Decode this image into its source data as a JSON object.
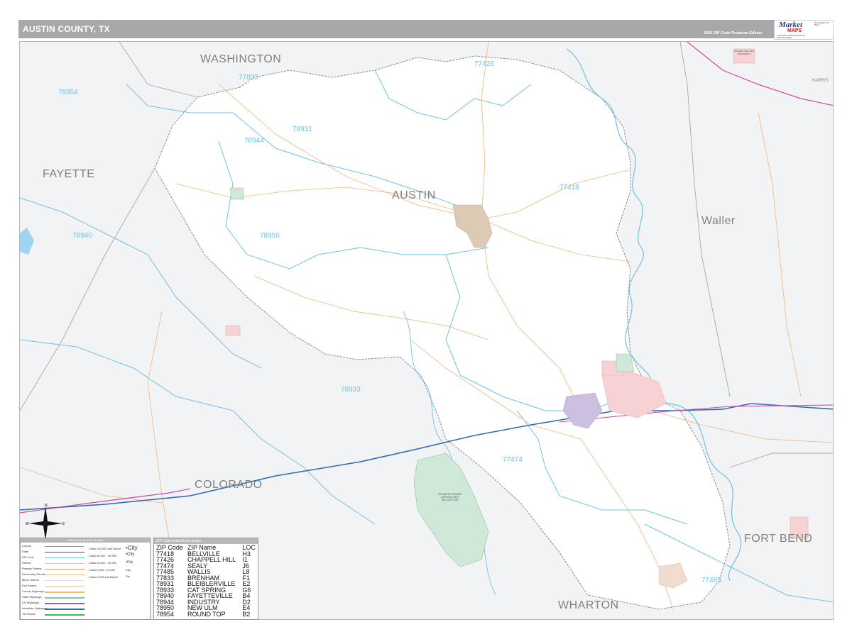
{
  "header": {
    "title": "AUSTIN COUNTY, TX",
    "edition": "2026 ZIP Code Premium Edition"
  },
  "logo": {
    "brand_top": "Market",
    "brand_bottom": "MAPS",
    "tagline": "America's Leading Source of Business Maps",
    "slogan": "The Navigator, The Places"
  },
  "map": {
    "counties": [
      {
        "id": "washington",
        "label": "WASHINGTON"
      },
      {
        "id": "fayette",
        "label": "FAYETTE"
      },
      {
        "id": "austin",
        "label": "AUSTIN"
      },
      {
        "id": "waller",
        "label": "Waller"
      },
      {
        "id": "colorado",
        "label": "COLORADO"
      },
      {
        "id": "fortbend",
        "label": "FORT BEND"
      },
      {
        "id": "wharton",
        "label": "WHARTON"
      },
      {
        "id": "harris",
        "label": "HARRIS"
      }
    ],
    "zip_labels": [
      {
        "id": "z77426",
        "label": "77426"
      },
      {
        "id": "z77833",
        "label": "77833"
      },
      {
        "id": "z78954",
        "label": "78954"
      },
      {
        "id": "z78931",
        "label": "78931"
      },
      {
        "id": "z78944",
        "label": "78944"
      },
      {
        "id": "z77418",
        "label": "77418"
      },
      {
        "id": "z78940",
        "label": "78940"
      },
      {
        "id": "z78950",
        "label": "78950"
      },
      {
        "id": "z78933",
        "label": "78933"
      },
      {
        "id": "z77474",
        "label": "77474"
      },
      {
        "id": "z77485",
        "label": "77485"
      }
    ],
    "place_labels": {
      "refuge": "ATTWATER PRAIRIE CHICKEN NATL WILDLIFE REF",
      "prairie_view": "PRAIRIE VIEW A&M UNIVERSITY"
    }
  },
  "legend": {
    "title": "2026 Austin County, TX Map",
    "left_rows": [
      "County",
      "State",
      "ZIP Code",
      "Streets",
      "Primary Streets",
      "Secondary Streets",
      "Minor Streets",
      "Exit Ramps",
      "County Highways",
      "State Highways",
      "US Highways",
      "Interstate Highways",
      "Toll Roads"
    ],
    "pop_rows": [
      "Cities 100,000 and Above",
      "Cities 50,000 - 99,999",
      "Cities 25,000 - 49,999",
      "Cities 5,000 - 24,999",
      "Cities 4,999 and Below"
    ],
    "city_samples": [
      "•City",
      "•City",
      "•City",
      "City",
      "City"
    ],
    "colors": {
      "county": "#9a9a9a",
      "state": "#555555",
      "zip": "#6ec2e6",
      "streets": "#cccccc",
      "primary": "#f0a36a",
      "secondary": "#e7c27b",
      "minor": "#dddddd",
      "exit": "#f7c6a6",
      "county_hwy": "#f3b46b",
      "state_hwy": "#7ec8a8",
      "us_hwy": "#d24aa0",
      "interstate": "#2b6cb3",
      "toll": "#3cb56a"
    }
  },
  "zip_index": {
    "title": "ZIP Code Index/Grid Locator",
    "headers": [
      "ZIP Code",
      "ZIP Name",
      "LOC"
    ],
    "rows": [
      [
        "77418",
        "BELLVILLE",
        "H3"
      ],
      [
        "77426",
        "CHAPPELL HILL",
        "I1"
      ],
      [
        "77474",
        "SEALY",
        "J6"
      ],
      [
        "77485",
        "WALLIS",
        "L8"
      ],
      [
        "77833",
        "BRENHAM",
        "F1"
      ],
      [
        "78931",
        "BLEIBLERVILLE",
        "E2"
      ],
      [
        "78933",
        "CAT SPRING",
        "G6"
      ],
      [
        "78940",
        "FAYETTEVILLE",
        "B4"
      ],
      [
        "78944",
        "INDUSTRY",
        "D2"
      ],
      [
        "78950",
        "NEW ULM",
        "E4"
      ],
      [
        "78954",
        "ROUND TOP",
        "B2"
      ]
    ]
  },
  "compass": {
    "n": "N",
    "s": "S",
    "e": "E",
    "w": "W"
  }
}
